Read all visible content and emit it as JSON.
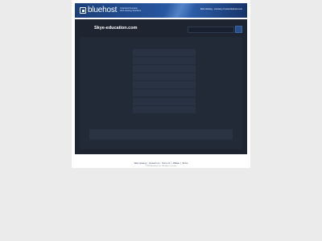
{
  "banner": {
    "logo_text": "bluehost",
    "tagline_line1": "Unlimited Domains",
    "tagline_line2": "Web Hosting Solutions",
    "courtesy": "Web Hosting - courtesy of www.bluehost.com"
  },
  "header": {
    "site_title": "Skye-education.com",
    "search_placeholder": ""
  },
  "content": {
    "links": [
      "",
      "",
      "",
      "",
      "",
      "",
      "",
      "",
      "",
      "",
      "",
      ""
    ],
    "related_bar": ""
  },
  "footer": {
    "links": [
      "Web Hosting",
      "Contact Us",
      "Terms of",
      "Affiliate",
      "Terms"
    ],
    "copyright": "©2023 Bluehost, Inc. All rights reserved."
  },
  "colors": {
    "page_bg": "#ebebeb",
    "banner_blue": "#24529a",
    "main_dark": "#1e2430",
    "content_panel": "#222a38",
    "search_button": "#2a4f86"
  },
  "icons": {
    "logo_mark": "bluehost-logo-icon",
    "search": "search-icon"
  }
}
